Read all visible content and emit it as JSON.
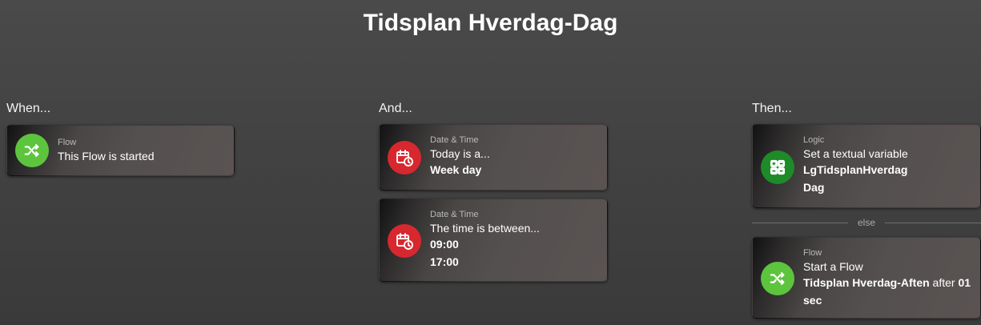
{
  "title": "Tidsplan Hverdag-Dag",
  "colors": {
    "flow_green": "#5dc43e",
    "datetime_red": "#d7282f",
    "logic_green": "#1e8a28"
  },
  "when": {
    "header": "When...",
    "cards": [
      {
        "category": "Flow",
        "icon": "flow-shuffle-icon",
        "line1": "This Flow is started"
      }
    ]
  },
  "and": {
    "header": "And...",
    "cards": [
      {
        "category": "Date & Time",
        "icon": "calendar-clock-icon",
        "line1": "Today is a...",
        "arg1": "Week day"
      },
      {
        "category": "Date & Time",
        "icon": "calendar-clock-icon",
        "line1": "The time is between...",
        "arg1": "09:00",
        "arg2": "17:00"
      }
    ]
  },
  "then": {
    "header": "Then...",
    "cards": [
      {
        "category": "Logic",
        "icon": "calculator-icon",
        "line1": "Set a textual variable",
        "arg1": "LgTidsplanHverdag",
        "arg2": "Dag"
      },
      {
        "category": "Flow",
        "icon": "flow-shuffle-icon",
        "line1": "Start a Flow",
        "arg1": "Tidsplan Hverdag-Aften",
        "connector": " after ",
        "arg2": "01",
        "arg3": "sec"
      }
    ],
    "else_label": "else"
  }
}
